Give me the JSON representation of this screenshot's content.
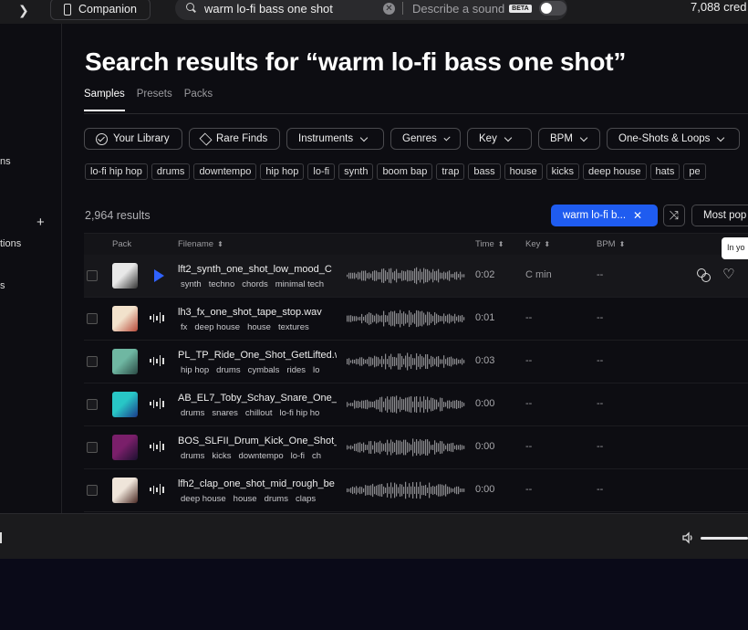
{
  "topbar": {
    "companion_label": "Companion",
    "search_query": "warm lo-fi bass one shot",
    "describe_label": "Describe a sound",
    "beta_badge": "BETA",
    "credits": "7,088 cred"
  },
  "sidebar": {
    "labels": [
      "ns",
      "tions",
      "s"
    ]
  },
  "page": {
    "title": "Search results for “warm lo-fi bass one shot”",
    "tabs": [
      {
        "label": "Samples",
        "active": true
      },
      {
        "label": "Presets",
        "active": false
      },
      {
        "label": "Packs",
        "active": false
      }
    ]
  },
  "filters": {
    "your_library": "Your Library",
    "rare_finds": "Rare Finds",
    "instruments": "Instruments",
    "genres": "Genres",
    "key": "Key",
    "bpm": "BPM",
    "one_shots": "One-Shots & Loops"
  },
  "tags": [
    "lo-fi hip hop",
    "drums",
    "downtempo",
    "hip hop",
    "lo-fi",
    "synth",
    "boom bap",
    "trap",
    "bass",
    "house",
    "kicks",
    "deep house",
    "hats",
    "pe"
  ],
  "results": {
    "count": "2,964 results",
    "active_chip": "warm lo-fi b...",
    "sort_label": "Most pop",
    "tooltip": "In yo"
  },
  "columns": {
    "pack": "Pack",
    "filename": "Filename",
    "time": "Time",
    "key": "Key",
    "bpm": "BPM"
  },
  "rows": [
    {
      "filename": "lft2_synth_one_shot_low_mood_C",
      "tags": [
        "synth",
        "techno",
        "chords",
        "minimal tech"
      ],
      "time": "0:02",
      "key": "C min",
      "bpm": "--",
      "art": [
        "#e8e8e8",
        "#333333"
      ]
    },
    {
      "filename": "lh3_fx_one_shot_tape_stop.wav",
      "tags": [
        "fx",
        "deep house",
        "house",
        "textures"
      ],
      "time": "0:01",
      "key": "--",
      "bpm": "--",
      "art": [
        "#f2e2cc",
        "#b84a3a"
      ]
    },
    {
      "filename": "PL_TP_Ride_One_Shot_GetLifted.w",
      "tags": [
        "hip hop",
        "drums",
        "cymbals",
        "rides",
        "lo"
      ],
      "time": "0:03",
      "key": "--",
      "bpm": "--",
      "art": [
        "#6fb7a2",
        "#2b4a44"
      ]
    },
    {
      "filename": "AB_EL7_Toby_Schay_Snare_One_S",
      "tags": [
        "drums",
        "snares",
        "chillout",
        "lo-fi hip ho"
      ],
      "time": "0:00",
      "key": "--",
      "bpm": "--",
      "art": [
        "#28c6c6",
        "#1b3a8a"
      ]
    },
    {
      "filename": "BOS_SLFII_Drum_Kick_One_Shot_",
      "tags": [
        "drums",
        "kicks",
        "downtempo",
        "lo-fi",
        "ch"
      ],
      "time": "0:00",
      "key": "--",
      "bpm": "--",
      "art": [
        "#7a1f6a",
        "#1c1030"
      ]
    },
    {
      "filename": "lfh2_clap_one_shot_mid_rough_be",
      "tags": [
        "deep house",
        "house",
        "drums",
        "claps"
      ],
      "time": "0:00",
      "key": "--",
      "bpm": "--",
      "art": [
        "#efe5da",
        "#4a2a24"
      ]
    }
  ],
  "colors": {
    "accent": "#1f5cf0",
    "play": "#2f62ff",
    "background": "#0d0d12"
  }
}
